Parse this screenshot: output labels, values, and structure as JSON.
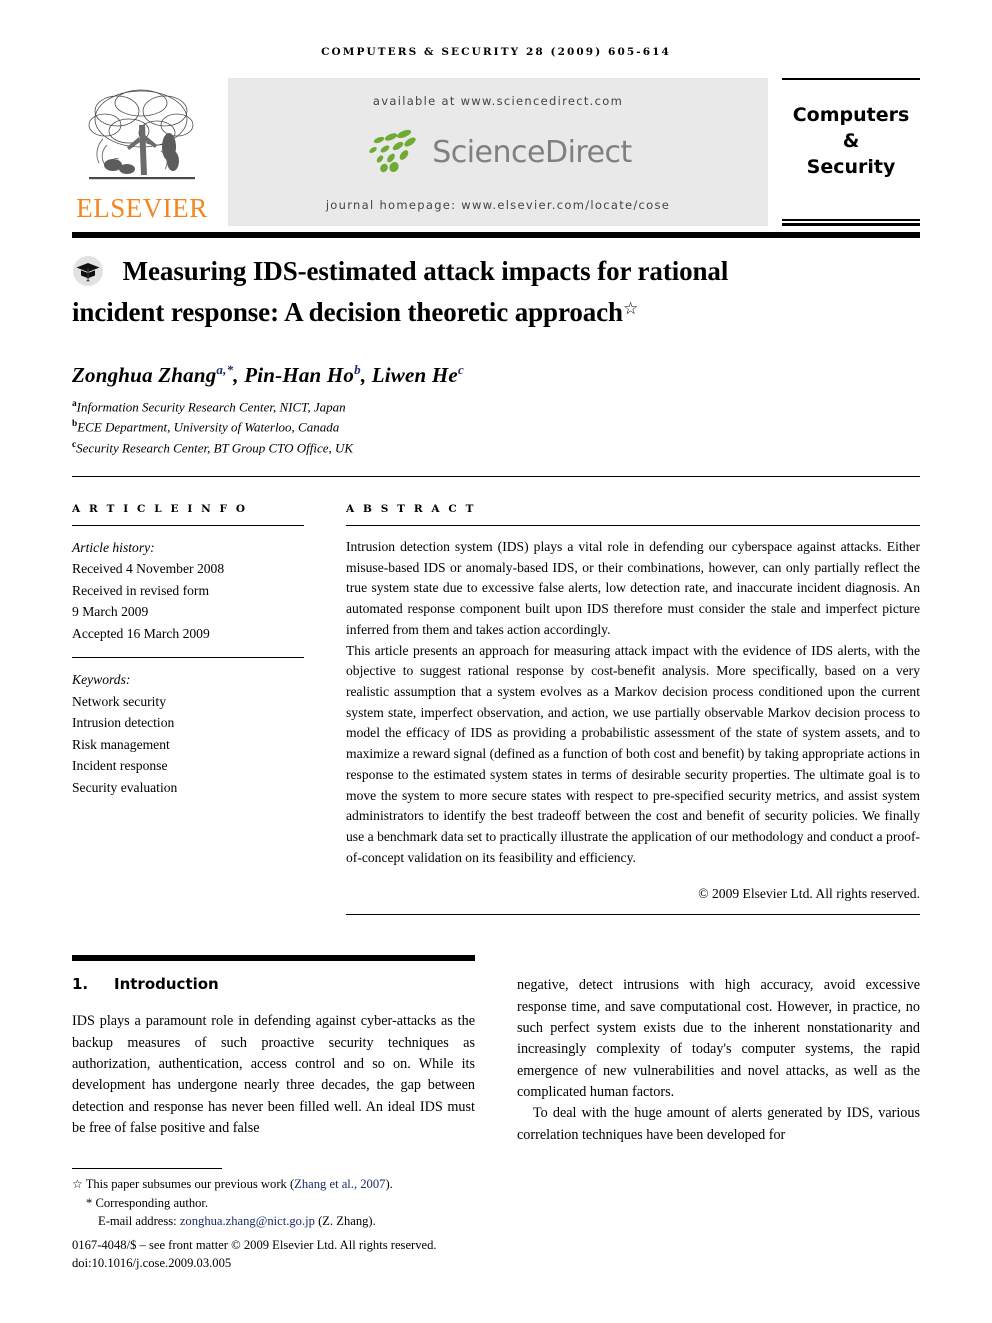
{
  "running_head": "COMPUTERS & SECURITY 28 (2009) 605-614",
  "masthead": {
    "publisher_name": "ELSEVIER",
    "publisher_logo_icon": "elsevier-tree-icon",
    "banner": {
      "available_at": "available at www.sciencedirect.com",
      "logo_wordmark": "ScienceDirect",
      "logo_icon": "sciencedirect-leaves-icon",
      "journal_homepage": "journal homepage: www.elsevier.com/locate/cose"
    },
    "journal_box": {
      "line1": "Computers",
      "line2": "&",
      "line3": "Security"
    }
  },
  "article": {
    "title_icon": "graduation-cap-icon",
    "title_line1": "Measuring IDS-estimated attack impacts for rational",
    "title_line2": "incident response: A decision theoretic approach",
    "title_footnote_marker": "☆",
    "authors": [
      {
        "name": "Zonghua Zhang",
        "sup": "a,*"
      },
      {
        "name": "Pin-Han Ho",
        "sup": "b"
      },
      {
        "name": "Liwen He",
        "sup": "c"
      }
    ],
    "affiliations": [
      {
        "marker": "a",
        "text": "Information Security Research Center, NICT, Japan"
      },
      {
        "marker": "b",
        "text": "ECE Department, University of Waterloo, Canada"
      },
      {
        "marker": "c",
        "text": "Security Research Center, BT Group CTO Office, UK"
      }
    ]
  },
  "article_info": {
    "heading": "A R T I C L E   I N F O",
    "history_label": "Article history:",
    "history": [
      "Received 4 November 2008",
      "Received in revised form",
      "9 March 2009",
      "Accepted 16 March 2009"
    ],
    "keywords_label": "Keywords:",
    "keywords": [
      "Network security",
      "Intrusion detection",
      "Risk management",
      "Incident response",
      "Security evaluation"
    ]
  },
  "abstract": {
    "heading": "A B S T R A C T",
    "paragraph1": "Intrusion detection system (IDS) plays a vital role in defending our cyberspace against attacks. Either misuse-based IDS or anomaly-based IDS, or their combinations, however, can only partially reflect the true system state due to excessive false alerts, low detection rate, and inaccurate incident diagnosis. An automated response component built upon IDS therefore must consider the stale and imperfect picture inferred from them and takes action accordingly.",
    "paragraph2": "This article presents an approach for measuring attack impact with the evidence of IDS alerts, with the objective to suggest rational response by cost-benefit analysis. More specifically, based on a very realistic assumption that a system evolves as a Markov decision process conditioned upon the current system state, imperfect observation, and action, we use partially observable Markov decision process to model the efficacy of IDS as providing a probabilistic assessment of the state of system assets, and to maximize a reward signal (defined as a function of both cost and benefit) by taking appropriate actions in response to the estimated system states in terms of desirable security properties. The ultimate goal is to move the system to more secure states with respect to pre-specified security metrics, and assist system administrators to identify the best tradeoff between the cost and benefit of security policies. We finally use a benchmark data set to practically illustrate the application of our methodology and conduct a proof-of-concept validation on its feasibility and efficiency.",
    "copyright": "© 2009 Elsevier Ltd. All rights reserved."
  },
  "body": {
    "section_number": "1.",
    "section_title": "Introduction",
    "left_paragraph": "IDS plays a paramount role in defending against cyber-attacks as the backup measures of such proactive security techniques as authorization, authentication, access control and so on. While its development has undergone nearly three decades, the gap between detection and response has never been filled well. An ideal IDS must be free of false positive and false",
    "right_paragraph1": "negative, detect intrusions with high accuracy, avoid excessive response time, and save computational cost. However, in practice, no such perfect system exists due to the inherent nonstationarity and increasingly complexity of today's computer systems, the rapid emergence of new vulnerabilities and novel attacks, as well as the complicated human factors.",
    "right_paragraph2": "To deal with the huge amount of alerts generated by IDS, various correlation techniques have been developed for"
  },
  "footer": {
    "footnote_star_marker": "☆",
    "footnote_star_text_before": "This paper subsumes our previous work (",
    "footnote_star_citation": "Zhang et al., 2007",
    "footnote_star_text_after": ").",
    "corresponding_marker": "*",
    "corresponding_text": "Corresponding author.",
    "email_label": "E-mail address:",
    "email_address": "zonghua.zhang@nict.go.jp",
    "email_suffix": "(Z. Zhang).",
    "issn_line": "0167-4048/$ – see front matter © 2009 Elsevier Ltd. All rights reserved.",
    "doi_line": "doi:10.1016/j.cose.2009.03.005"
  },
  "colors": {
    "elsevier_orange": "#f5851f",
    "sciencedirect_green": "#6faa35",
    "sciencedirect_gray": "#7f8180",
    "link_blue": "#1b2a6b",
    "banner_bg": "#e9e9e9"
  }
}
